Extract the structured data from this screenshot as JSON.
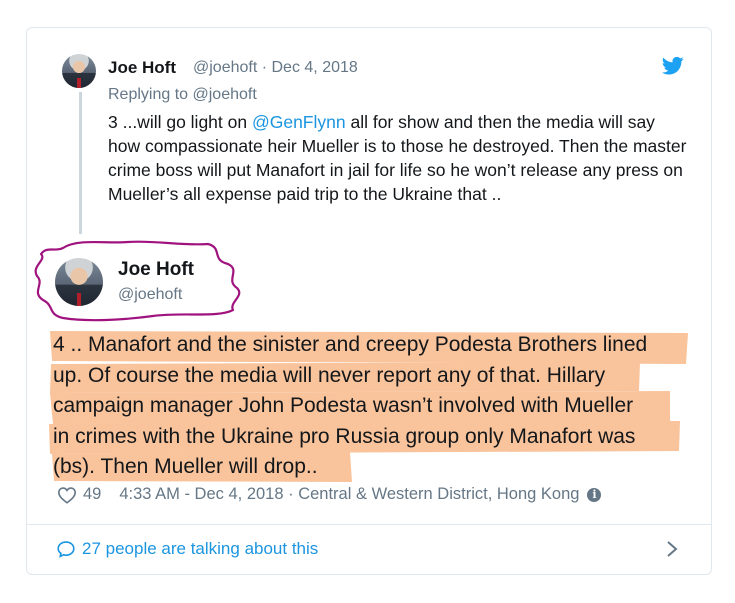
{
  "reply_tweet": {
    "author_name": "Joe Hoft",
    "handle_date": "@joehoft · Dec 4, 2018",
    "replying_to": "Replying to @joehoft",
    "text_before": "3 ...will go light on ",
    "mention": "@GenFlynn",
    "text_after": " all for show and then the media will say how compassionate heir Mueller is to those he destroyed. Then the master crime boss will put Manafort in jail for life so he won’t release any press on Mueller’s all expense paid trip to the Ukraine that ..",
    "avatar_icon": "profile-photo"
  },
  "main_tweet": {
    "author_name": "Joe Hoft",
    "handle": "@joehoft",
    "lines": [
      "4 .. Manafort and the sinister and creepy Podesta Brothers lined",
      "up. Of course the media will never report any of that. Hillary",
      "campaign manager John Podesta wasn’t involved with Mueller",
      "in crimes with the Ukraine pro Russia group only Manafort was",
      "(bs).  Then Mueller will drop.."
    ],
    "highlight_color": "#f8b98a",
    "scribble_color": "#a0137f"
  },
  "footer": {
    "likes": "49",
    "timestamp_location": "4:33 AM - Dec 4, 2018 · Central & Western District, Hong Kong",
    "info_icon": "i",
    "talking": "27 people are talking about this"
  },
  "colors": {
    "link": "#1b95e0",
    "muted": "#657786",
    "border": "#e1e8ed"
  }
}
